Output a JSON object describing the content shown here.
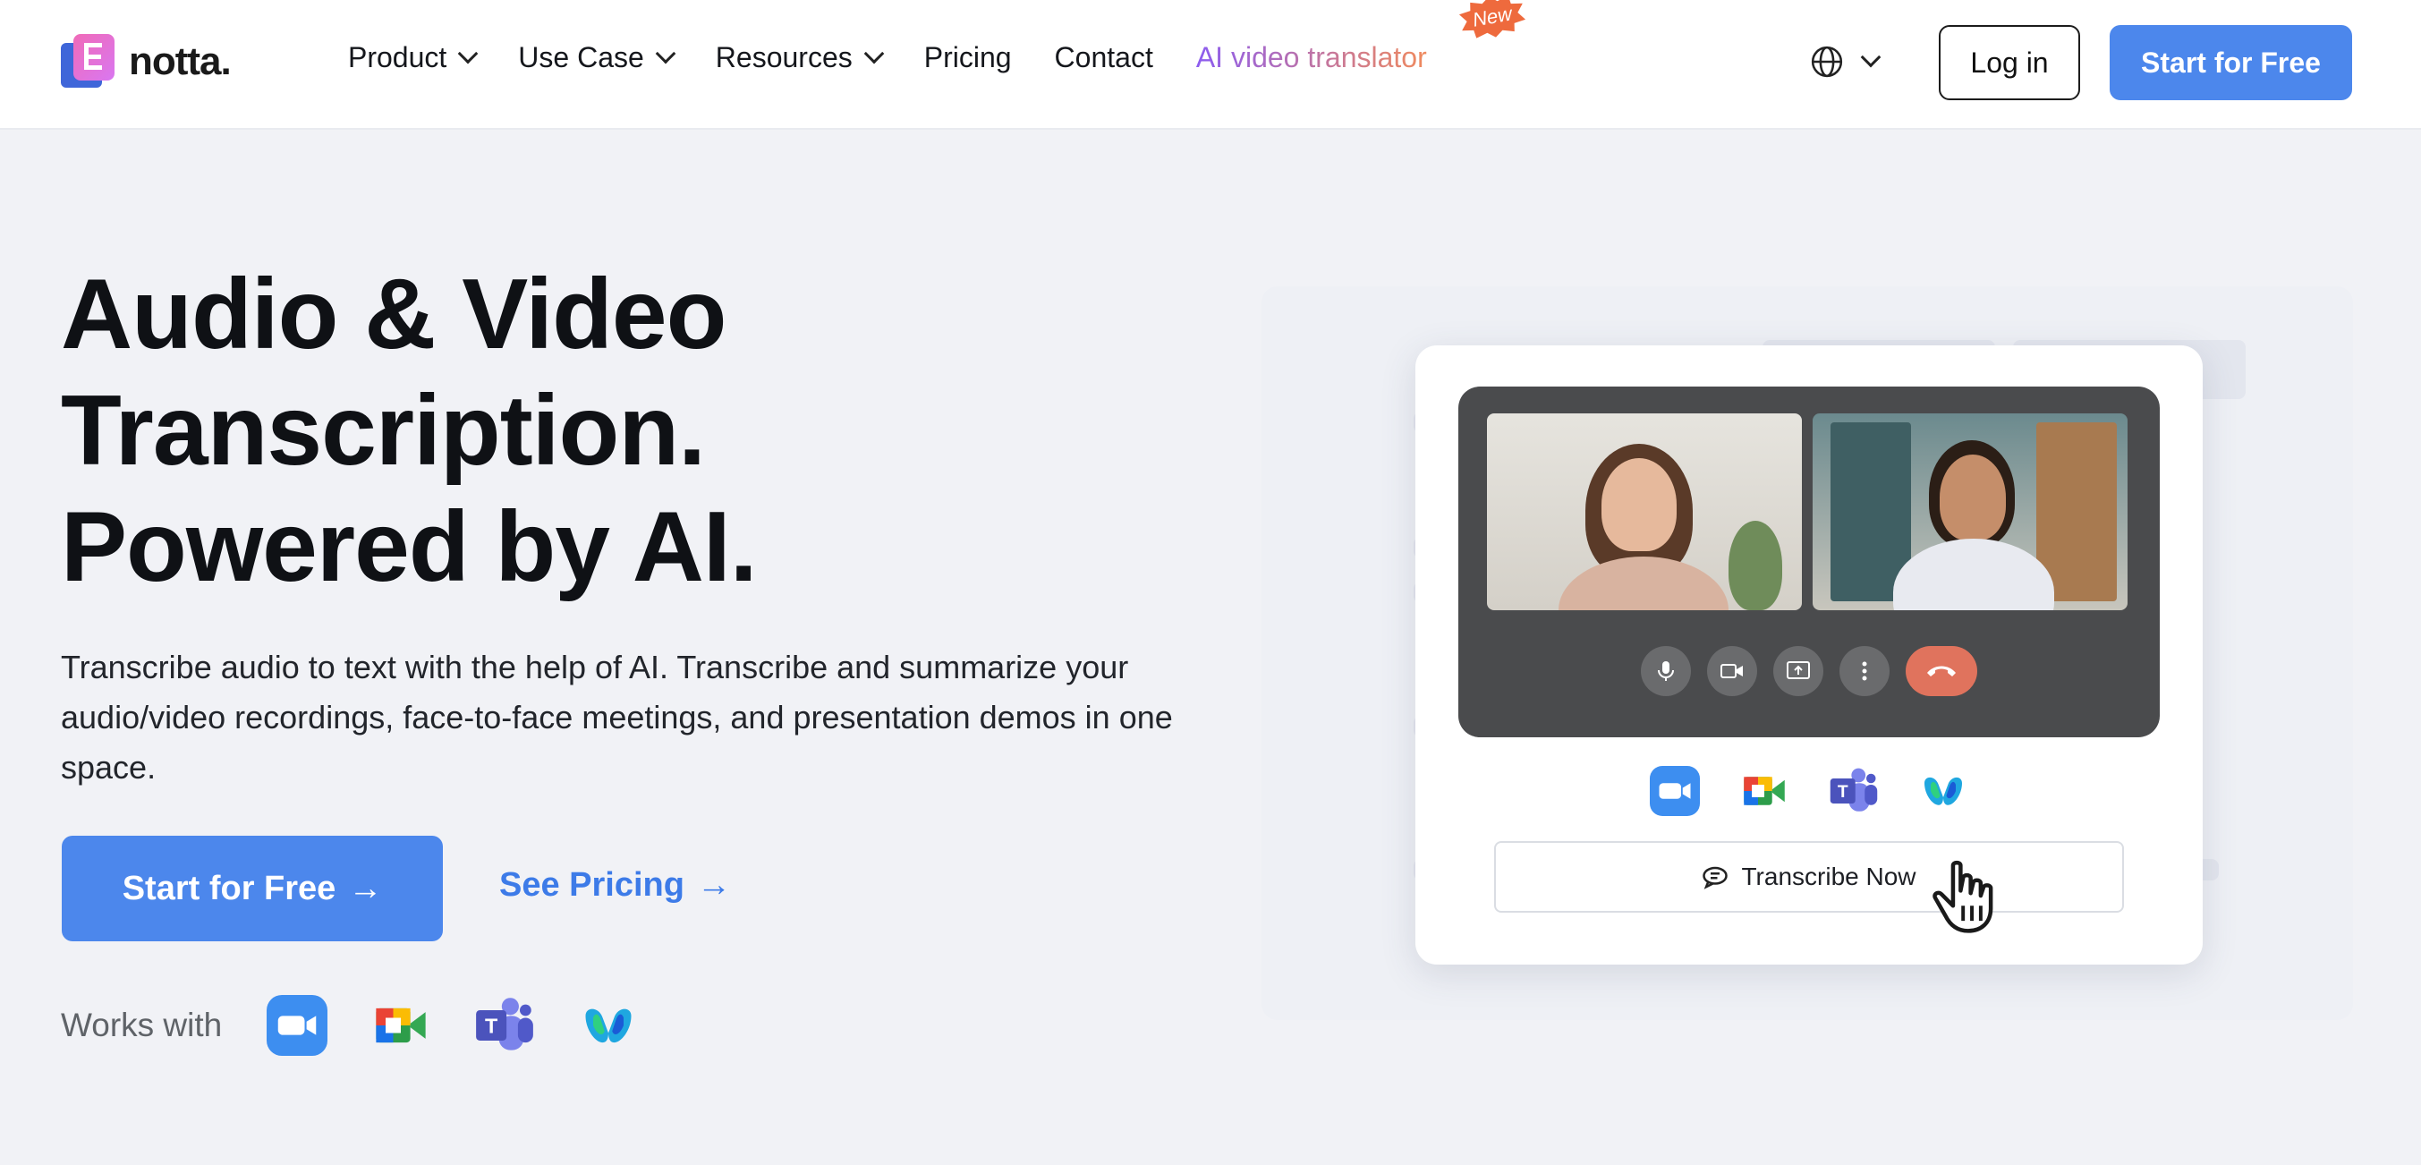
{
  "header": {
    "logo_text": "notta.",
    "nav": [
      {
        "label": "Product",
        "has_dropdown": true
      },
      {
        "label": "Use Case",
        "has_dropdown": true
      },
      {
        "label": "Resources",
        "has_dropdown": true
      },
      {
        "label": "Pricing",
        "has_dropdown": false
      },
      {
        "label": "Contact",
        "has_dropdown": false
      }
    ],
    "ai_link": "AI video translator",
    "new_badge": "New",
    "language_icon": "globe-icon",
    "login_label": "Log in",
    "start_label": "Start for Free"
  },
  "hero": {
    "title_line1": "Audio & Video",
    "title_line2": "Transcription.",
    "title_line3": "Powered by AI.",
    "subtitle": "Transcribe audio to text with the help of AI. Transcribe and summarize your audio/video recordings, face-to-face meetings, and presentation demos in one space.",
    "cta_primary": "Start for Free",
    "cta_secondary": "See Pricing",
    "works_with_label": "Works with",
    "integrations": [
      "zoom-icon",
      "google-meet-icon",
      "microsoft-teams-icon",
      "webex-icon"
    ]
  },
  "illustration": {
    "transcribe_label": "Transcribe Now",
    "controls": [
      "microphone-icon",
      "camera-icon",
      "share-screen-icon",
      "more-icon",
      "end-call-icon"
    ]
  },
  "colors": {
    "accent": "#4c87ec",
    "end_call": "#e0735d",
    "badge": "#ee6a3d"
  }
}
